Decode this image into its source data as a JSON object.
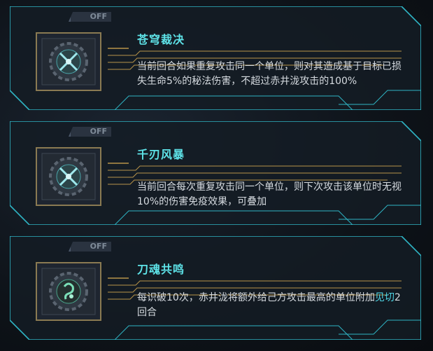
{
  "skills": [
    {
      "name": "苍穹裁决",
      "status": "OFF",
      "icon": "crossed-swords-gear-icon",
      "description": "当前回合如果重复攻击同一个单位，则对其造成基于目标已损失生命5%的秘法伤害，不超过赤井泷攻击的100%"
    },
    {
      "name": "千刃风暴",
      "status": "OFF",
      "icon": "crossed-swords-gear-icon",
      "description": "当前回合每次重复攻击同一个单位，则下次攻击该单位时无视10%的伤害免疫效果，可叠加"
    },
    {
      "name": "刀魂共鸣",
      "status": "OFF",
      "icon": "spirit-blade-gear-icon",
      "description_before": "每识破10次，赤井泷将额外给己方攻击最高的单位附加",
      "description_highlight": "见切",
      "description_after": "2回合"
    }
  ],
  "colors": {
    "accent": "#5ee3e8",
    "frame": "#2fb4c4",
    "gold": "#b8944a",
    "text": "#d6dbe0"
  }
}
